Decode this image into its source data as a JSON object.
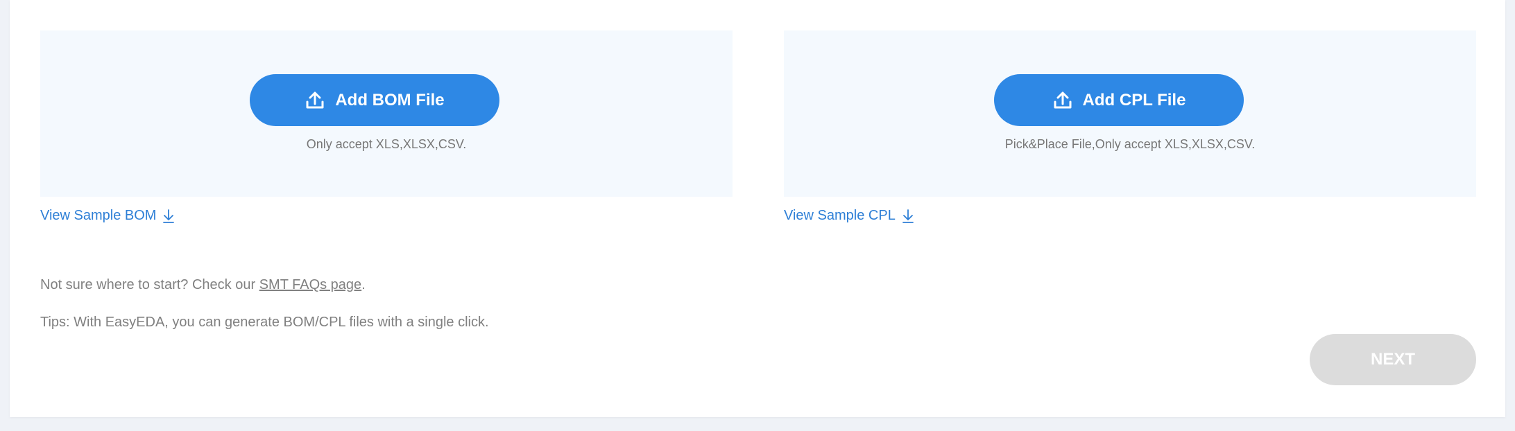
{
  "bom": {
    "button_label": "Add BOM File",
    "accept_note": "Only accept XLS,XLSX,CSV.",
    "sample_link": "View Sample BOM"
  },
  "cpl": {
    "button_label": "Add CPL File",
    "accept_note": "Pick&Place File,Only accept XLS,XLSX,CSV.",
    "sample_link": "View Sample CPL"
  },
  "help": {
    "prefix": "Not sure where to start? Check our ",
    "link": "SMT FAQs page",
    "suffix": "."
  },
  "tips": "Tips: With EasyEDA, you can generate BOM/CPL files with a single click.",
  "next_button": "NEXT",
  "icons": {
    "upload": "upload-icon",
    "download": "download-arrow-icon"
  },
  "colors": {
    "primary": "#2e88e5",
    "link": "#2e7fd6",
    "upload_bg": "#f4f9fe",
    "disabled": "#dcdcdc",
    "muted_text": "#808080"
  }
}
